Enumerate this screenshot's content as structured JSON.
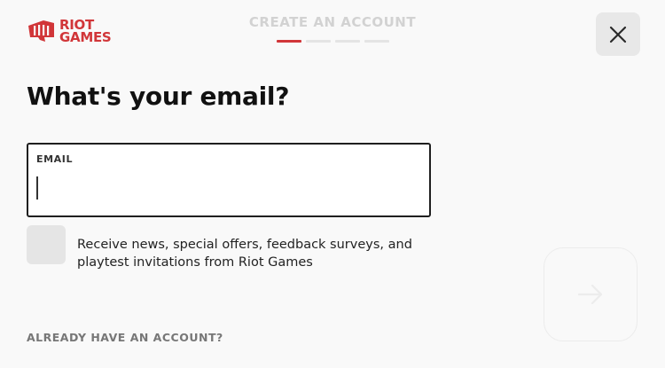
{
  "brand": {
    "logo_line1": "RIOT",
    "logo_line2": "GAMES",
    "color": "#d13639"
  },
  "stepper": {
    "title": "CREATE AN ACCOUNT",
    "total_steps": 4,
    "current_step": 1
  },
  "form": {
    "heading": "What's your email?",
    "email_label": "EMAIL",
    "email_value": "",
    "newsletter_label": "Receive news, special offers, feedback surveys, and playtest invitations from Riot Games",
    "newsletter_checked": false
  },
  "footer": {
    "signin_link": "ALREADY HAVE AN ACCOUNT?"
  },
  "icons": {
    "close": "close-icon",
    "next": "arrow-right-icon",
    "logo": "riot-fist-logo"
  }
}
